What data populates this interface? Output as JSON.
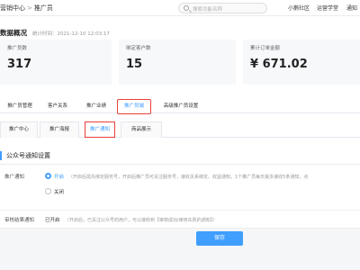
{
  "topbar": {
    "breadcrumb_parent": "营销中心",
    "breadcrumb_separator": ">",
    "breadcrumb_current": "推广员",
    "search_placeholder": "搜索功能名称",
    "links": [
      "小鹅社区",
      "运营学堂",
      "通知"
    ]
  },
  "overview": {
    "title": "数据概况",
    "stats_time": "统计时间：2021-12-10 12:03:17"
  },
  "stats": [
    {
      "label": "推广员数",
      "value": "317"
    },
    {
      "label": "绑定客户数",
      "value": "15"
    },
    {
      "label": "累计订单金额",
      "value": "¥ 671.02"
    }
  ],
  "tabs": [
    {
      "label": "推广员管理",
      "active": false
    },
    {
      "label": "客户关系",
      "active": false
    },
    {
      "label": "推广业绩",
      "active": false
    },
    {
      "label": "推广员端",
      "active": true
    },
    {
      "label": "高级推广员设置",
      "active": false
    }
  ],
  "subtabs": [
    {
      "label": "推广中心",
      "active": false
    },
    {
      "label": "推广海报",
      "active": false
    },
    {
      "label": "推广通知",
      "active": true
    },
    {
      "label": "商品展示",
      "active": false
    }
  ],
  "section": {
    "title": "公众号通知设置"
  },
  "form": {
    "promotion_notice_label": "推广通知",
    "option_on": "开启",
    "option_on_hint": "（开启后需先绑定服务号，开启后推广员可关注服务号，接收关系绑定、收益通知。1个推广员每天最多接收5条通知，点",
    "option_off": "关闭",
    "review_notice_label": "审核结果通知",
    "review_status": "已开启",
    "review_hint": "（开启后，已关注公众号的用户，可以接收到【审核成功/审核失败的通知】）"
  },
  "footer": {
    "save_label": "保存"
  },
  "colors": {
    "accent": "#409eff",
    "highlight_border": "#e8403a"
  }
}
